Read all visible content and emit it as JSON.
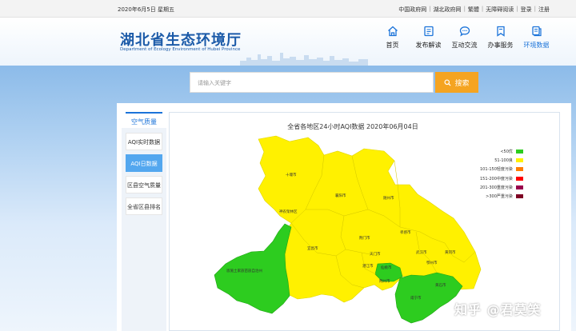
{
  "topbar": {
    "date": "2020年6月5日 星期五",
    "links": [
      "中国政府网",
      "湖北政府网",
      "繁體",
      "无障碍阅读",
      "登录",
      "注册"
    ]
  },
  "header": {
    "logo_cn": "湖北省生态环境厅",
    "logo_en": "Department of Ecology Environment of Hubei Province",
    "nav": [
      {
        "label": "首页",
        "icon": "home-icon",
        "active": false
      },
      {
        "label": "发布解读",
        "icon": "document-icon",
        "active": false
      },
      {
        "label": "互动交流",
        "icon": "chat-icon",
        "active": false
      },
      {
        "label": "办事服务",
        "icon": "bookmark-icon",
        "active": false
      },
      {
        "label": "环境数据",
        "icon": "data-icon",
        "active": true
      }
    ]
  },
  "search": {
    "placeholder": "请输入关键字",
    "button_label": "搜索"
  },
  "sidebar": {
    "title": "空气质量",
    "items": [
      "AQI实时数据",
      "AQI日数据",
      "区县空气质量",
      "全省区县排名"
    ],
    "active_index": 1
  },
  "map": {
    "title": "全省各地区24小时AQI数据 2020年06月04日",
    "legend": [
      {
        "label": "<50优",
        "color": "#2dcc1f"
      },
      {
        "label": "51-100良",
        "color": "#fff100"
      },
      {
        "label": "101-150轻度污染",
        "color": "#ff7e00"
      },
      {
        "label": "151-200中度污染",
        "color": "#ff0000"
      },
      {
        "label": "201-300重度污染",
        "color": "#99004c"
      },
      {
        "label": ">300严重污染",
        "color": "#7e0023"
      }
    ],
    "cities": [
      "十堰市",
      "神农架林区",
      "襄阳市",
      "随州市",
      "孝感市",
      "宜昌市",
      "荆门市",
      "天门市",
      "潜江市",
      "仙桃市",
      "武汉市",
      "鄂州市",
      "黄冈市",
      "恩施土家族苗族自治州",
      "荆州市",
      "咸宁市",
      "黄石市"
    ]
  },
  "watermark": "知乎 @君莫笑"
}
